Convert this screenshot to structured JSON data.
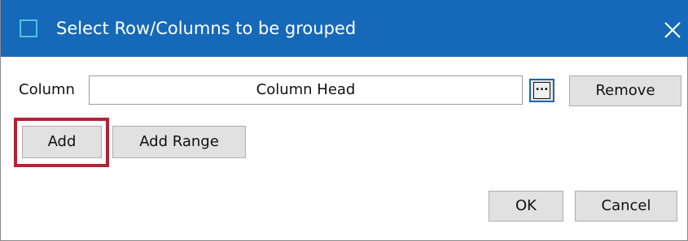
{
  "window": {
    "title": "Select Row/Columns to be grouped",
    "title_bar_color": "#1569b8",
    "icon": "window-icon",
    "close_icon": "close-icon"
  },
  "column_row": {
    "label": "Column",
    "value": "Column Head",
    "browse_label": "...",
    "browse_icon": "ellipsis-icon",
    "remove_label": "Remove"
  },
  "actions": {
    "add_label": "Add",
    "add_range_label": "Add Range",
    "highlight_color": "#b02433"
  },
  "footer": {
    "ok_label": "OK",
    "cancel_label": "Cancel"
  }
}
